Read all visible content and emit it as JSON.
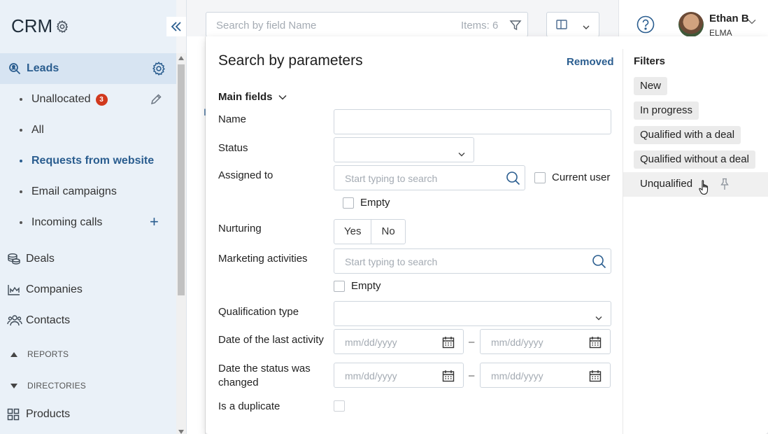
{
  "app": {
    "title": "CRM"
  },
  "sidebar": {
    "leads_label": "Leads",
    "sub_items": [
      {
        "label": "Unallocated",
        "badge": "3"
      },
      {
        "label": "All"
      },
      {
        "label": "Requests from website",
        "active": true
      },
      {
        "label": "Email campaigns"
      },
      {
        "label": "Incoming calls"
      }
    ],
    "nav": [
      {
        "label": "Deals",
        "icon": "coins-icon"
      },
      {
        "label": "Companies",
        "icon": "chart-icon"
      },
      {
        "label": "Contacts",
        "icon": "people-icon"
      }
    ],
    "sections": {
      "reports": "REPORTS",
      "directories": "DIRECTORIES"
    },
    "products_label": "Products"
  },
  "header": {
    "search_placeholder": "Search by field Name",
    "items_count": "Items: 6",
    "user_name": "Ethan B",
    "user_org": "ELMA"
  },
  "panel": {
    "title": "Search by parameters",
    "removed_link": "Removed",
    "main_fields_label": "Main fields",
    "fields": {
      "name": "Name",
      "status": "Status",
      "assigned_to": "Assigned to",
      "assigned_placeholder": "Start typing to search",
      "current_user": "Current user",
      "empty1": "Empty",
      "nurturing": "Nurturing",
      "yes": "Yes",
      "no": "No",
      "marketing": "Marketing activities",
      "marketing_placeholder": "Start typing to search",
      "empty2": "Empty",
      "qualification_type": "Qualification type",
      "last_activity": "Date of the last activity",
      "status_changed": "Date the status was changed",
      "date_placeholder": "mm/dd/yyyy",
      "dash": "–",
      "duplicate": "Is a duplicate"
    },
    "filters_title": "Filters",
    "filters": [
      "New",
      "In progress",
      "Qualified with a deal",
      "Qualified without a deal",
      "Unqualified"
    ]
  },
  "colors": {
    "accent": "#2a5d8f",
    "badge": "#d1391e",
    "sidebar_bg": "#eaf1f8"
  }
}
